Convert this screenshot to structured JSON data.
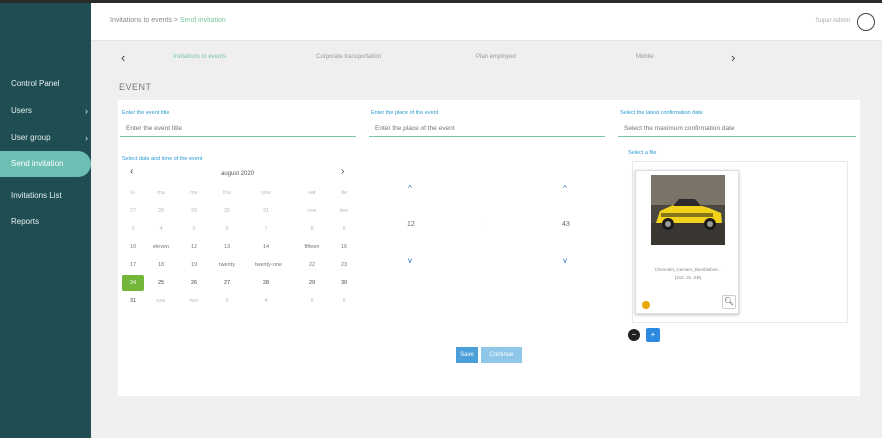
{
  "breadcrumb": {
    "parent": "Invitations to events",
    "separator": " > ",
    "current": "Send invitation"
  },
  "user": {
    "name": "Super Admin"
  },
  "sidebar": {
    "items": [
      {
        "label": "Control Panel",
        "chevron": ""
      },
      {
        "label": "Users",
        "chevron": "›"
      },
      {
        "label": "User group",
        "chevron": "›"
      },
      {
        "label": "Send invitation",
        "chevron": ""
      },
      {
        "label": "Invitations List",
        "chevron": ""
      },
      {
        "label": "Reports",
        "chevron": ""
      }
    ],
    "active_index": 3
  },
  "steps": {
    "prev": "‹",
    "next": "›",
    "items": [
      "Invitations to events",
      "Corporate transportation",
      "Plan employed",
      "Mobile"
    ]
  },
  "section_title": "EVENT",
  "form": {
    "title_label": "Enter the event title",
    "title_placeholder": "Enter the event title",
    "place_label": "Enter the place of the event",
    "place_placeholder": "Enter the place of the event",
    "confirm_label": "Select the latest confirmation date",
    "confirm_placeholder": "Select the maximum confirmation date",
    "date_label": "Select date and time of the event",
    "file_label": "Select a file"
  },
  "calendar": {
    "prev": "‹",
    "next": "›",
    "month": "august 2020",
    "weekdays": [
      "lu",
      "ma",
      "me",
      "thu",
      "sow",
      "sat",
      "de"
    ],
    "weeks": [
      [
        "27",
        "28",
        "29",
        "30",
        "31",
        "one",
        "two"
      ],
      [
        "3",
        "4",
        "5",
        "6",
        "7",
        "8",
        "9"
      ],
      [
        "10",
        "eleven",
        "12",
        "13",
        "14",
        "fifteen",
        "16"
      ],
      [
        "17",
        "18",
        "19",
        "twenty",
        "twenty-one",
        "22",
        "23"
      ],
      [
        "24",
        "25",
        "26",
        "27",
        "28",
        "29",
        "30"
      ],
      [
        "31",
        "one",
        "two",
        "3",
        "4",
        "5",
        "6"
      ]
    ]
  },
  "time": {
    "hours": "12",
    "separator": ":",
    "minutes": "43",
    "up": "^",
    "down": "v"
  },
  "file": {
    "name": "Chevrolet_Camaro_Bumblebee...",
    "size": "(312. 31. KB)"
  },
  "buttons": {
    "save": "Save",
    "continue": "Continue"
  },
  "colors": {
    "sidebar": "#1e4d52",
    "sidebar_active": "#6dbfb4",
    "accent": "#7cc6a0",
    "link": "#2b9ad3",
    "today": "#72b738",
    "button": "#4a9fd8",
    "car": "#f2d21a"
  }
}
